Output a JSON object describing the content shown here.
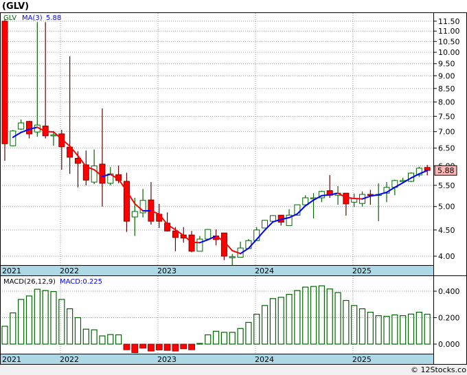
{
  "header": {
    "title": "(GLV)"
  },
  "legend": {
    "symbol": "GLV",
    "ma_label": "MA(3)",
    "ma_value": "5.88"
  },
  "macd_legend": {
    "label": "MACD(26,12,9)",
    "value_label": "MACD:0.225"
  },
  "last_price_badge": "5.88",
  "footer": {
    "copyright": "© 12Stocks.com"
  },
  "colors": {
    "up": "#006400",
    "down": "#ff0000",
    "ma_up": "#0000ff",
    "ma_down": "#ff0000",
    "axis_band": "#add8e6",
    "badge": "#ffb6b6"
  },
  "chart_data": [
    {
      "type": "candlestick",
      "title": "(GLV)",
      "y_scale": "log",
      "ylim": [
        3.8,
        11.6
      ],
      "y_ticks": [
        "11.50",
        "11.00",
        "10.50",
        "10.00",
        "9.50",
        "9.00",
        "8.50",
        "8.00",
        "7.50",
        "7.00",
        "6.50",
        "6.00",
        "5.50",
        "5.00",
        "4.50",
        "4.00"
      ],
      "x_ticks": [
        {
          "label": "2021",
          "index": -0.35
        },
        {
          "label": "2022",
          "index": 6.85
        },
        {
          "label": "2023",
          "index": 18.85
        },
        {
          "label": "2024",
          "index": 30.85
        },
        {
          "label": "2025",
          "index": 42.85
        }
      ],
      "grid": true,
      "moving_average": {
        "name": "MA(3)",
        "period": 3
      },
      "ohlc": [
        [
          11.5,
          6.63,
          11.6,
          6.14
        ],
        [
          6.57,
          7.02,
          7.05,
          6.55
        ],
        [
          7.08,
          7.28,
          7.39,
          7.05
        ],
        [
          7.33,
          6.93,
          7.35,
          6.79
        ],
        [
          6.99,
          7.21,
          11.45,
          6.84
        ],
        [
          7.18,
          6.87,
          11.45,
          6.79
        ],
        [
          6.9,
          6.9,
          7.02,
          6.57
        ],
        [
          6.93,
          6.54,
          7.06,
          5.9
        ],
        [
          6.53,
          6.24,
          9.82,
          5.79
        ],
        [
          6.21,
          6.07,
          6.41,
          5.45
        ],
        [
          6.03,
          5.63,
          6.43,
          5.5
        ],
        [
          5.58,
          6.0,
          6.46,
          5.53
        ],
        [
          6.05,
          5.55,
          7.77,
          5.0
        ],
        [
          5.55,
          5.79,
          5.97,
          5.5
        ],
        [
          5.77,
          5.62,
          6.01,
          5.55
        ],
        [
          5.6,
          4.68,
          5.82,
          4.46
        ],
        [
          4.77,
          4.89,
          5.2,
          4.38
        ],
        [
          4.86,
          5.14,
          5.41,
          4.76
        ],
        [
          5.15,
          4.68,
          5.58,
          4.61
        ],
        [
          4.83,
          4.68,
          5.06,
          4.54
        ],
        [
          4.64,
          4.48,
          4.87,
          4.47
        ],
        [
          4.48,
          4.35,
          4.56,
          4.09
        ],
        [
          4.4,
          4.34,
          4.56,
          4.25
        ],
        [
          4.4,
          4.09,
          4.48,
          4.07
        ],
        [
          4.09,
          4.32,
          4.38,
          4.09
        ],
        [
          4.32,
          4.51,
          4.52,
          4.3
        ],
        [
          4.38,
          4.31,
          4.51,
          4.2
        ],
        [
          4.44,
          4.0,
          4.44,
          3.93
        ],
        [
          3.98,
          3.99,
          4.04,
          3.82
        ],
        [
          3.98,
          4.15,
          4.27,
          3.98
        ],
        [
          4.14,
          4.29,
          4.32,
          4.13
        ],
        [
          4.29,
          4.5,
          4.56,
          4.29
        ],
        [
          4.54,
          4.7,
          4.71,
          4.54
        ],
        [
          4.68,
          4.8,
          4.81,
          4.68
        ],
        [
          4.81,
          4.66,
          4.81,
          4.59
        ],
        [
          4.59,
          4.81,
          4.94,
          4.59
        ],
        [
          4.81,
          5.04,
          5.04,
          4.81
        ],
        [
          5.04,
          5.2,
          5.26,
          5.04
        ],
        [
          5.18,
          5.2,
          5.31,
          4.74
        ],
        [
          5.2,
          5.35,
          5.37,
          5.1
        ],
        [
          5.37,
          5.26,
          5.76,
          5.2
        ],
        [
          5.26,
          5.31,
          5.48,
          5.04
        ],
        [
          5.31,
          5.06,
          5.31,
          4.8
        ],
        [
          5.1,
          5.18,
          5.3,
          4.99
        ],
        [
          5.07,
          5.28,
          5.35,
          5.0
        ],
        [
          5.28,
          5.26,
          5.39,
          5.04
        ],
        [
          5.26,
          5.28,
          5.55,
          4.68
        ],
        [
          5.31,
          5.45,
          5.58,
          5.1
        ],
        [
          5.45,
          5.62,
          5.64,
          5.26
        ],
        [
          5.6,
          5.62,
          5.69,
          5.58
        ],
        [
          5.6,
          5.81,
          5.83,
          5.58
        ],
        [
          5.76,
          5.94,
          5.98,
          5.71
        ],
        [
          5.96,
          5.88,
          6.03,
          5.75
        ]
      ]
    },
    {
      "type": "bar",
      "title": "MACD(26,12,9)",
      "ylim": [
        -0.08,
        0.5
      ],
      "y_ticks": [
        "0.400",
        "0.200",
        "0.000"
      ],
      "grid": true,
      "values": [
        0.135,
        0.236,
        0.338,
        0.364,
        0.415,
        0.405,
        0.397,
        0.338,
        0.267,
        0.2,
        0.113,
        0.108,
        0.062,
        0.072,
        0.07,
        -0.043,
        -0.065,
        -0.031,
        -0.053,
        -0.044,
        -0.048,
        -0.053,
        -0.036,
        -0.043,
        0.005,
        0.07,
        0.097,
        0.089,
        0.089,
        0.118,
        0.164,
        0.226,
        0.292,
        0.344,
        0.354,
        0.376,
        0.405,
        0.431,
        0.436,
        0.441,
        0.417,
        0.39,
        0.33,
        0.292,
        0.267,
        0.241,
        0.215,
        0.21,
        0.221,
        0.215,
        0.227,
        0.241,
        0.226
      ]
    }
  ]
}
